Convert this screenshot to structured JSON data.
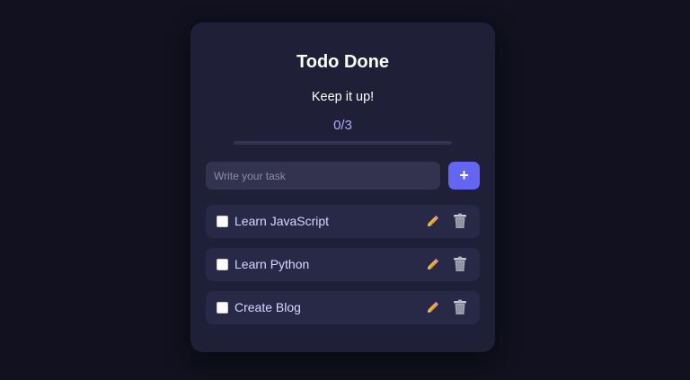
{
  "app": {
    "title": "Todo Done",
    "subtitle": "Keep it up!",
    "counter": "0/3",
    "progress_fraction": 0
  },
  "input": {
    "placeholder": "Write your task",
    "value": ""
  },
  "add_button": {
    "label": "+"
  },
  "tasks": [
    {
      "label": "Learn JavaScript",
      "done": false,
      "edit_icon": "pencil-icon",
      "delete_icon": "trash-icon"
    },
    {
      "label": "Learn Python",
      "done": false,
      "edit_icon": "pencil-icon",
      "delete_icon": "trash-icon"
    },
    {
      "label": "Create Blog",
      "done": false,
      "edit_icon": "pencil-icon",
      "delete_icon": "trash-icon"
    }
  ],
  "colors": {
    "background": "#11111f",
    "card": "#1f1f37",
    "accent": "#6366f1",
    "counter_text": "#a9aefc",
    "task_row": "#282847"
  }
}
